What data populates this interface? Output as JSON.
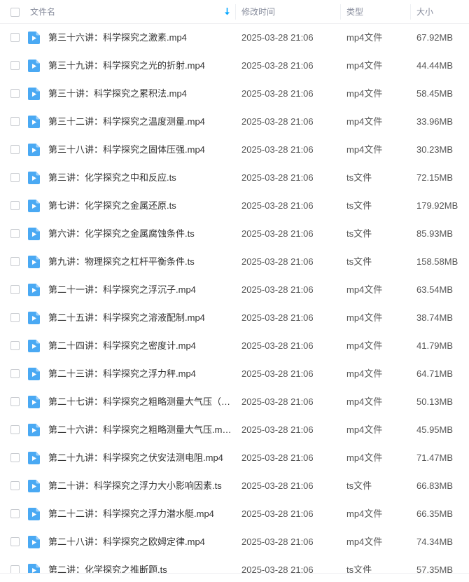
{
  "header": {
    "name_label": "文件名",
    "time_label": "修改时间",
    "type_label": "类型",
    "size_label": "大小"
  },
  "colors": {
    "accent": "#06a7ff",
    "icon": "#4aa9f3",
    "header_text": "#878c9c"
  },
  "files": [
    {
      "name": "第三十六讲：科学探究之激素.mp4",
      "time": "2025-03-28 21:06",
      "type": "mp4文件",
      "size": "67.92MB"
    },
    {
      "name": "第三十九讲：科学探究之光的折射.mp4",
      "time": "2025-03-28 21:06",
      "type": "mp4文件",
      "size": "44.44MB"
    },
    {
      "name": "第三十讲：科学探究之累积法.mp4",
      "time": "2025-03-28 21:06",
      "type": "mp4文件",
      "size": "58.45MB"
    },
    {
      "name": "第三十二讲：科学探究之温度测量.mp4",
      "time": "2025-03-28 21:06",
      "type": "mp4文件",
      "size": "33.96MB"
    },
    {
      "name": "第三十八讲：科学探究之固体压强.mp4",
      "time": "2025-03-28 21:06",
      "type": "mp4文件",
      "size": "30.23MB"
    },
    {
      "name": "第三讲：化学探究之中和反应.ts",
      "time": "2025-03-28 21:06",
      "type": "ts文件",
      "size": "72.15MB"
    },
    {
      "name": "第七讲：化学探究之金属还原.ts",
      "time": "2025-03-28 21:06",
      "type": "ts文件",
      "size": "179.92MB"
    },
    {
      "name": "第六讲：化学探究之金属腐蚀条件.ts",
      "time": "2025-03-28 21:06",
      "type": "ts文件",
      "size": "85.93MB"
    },
    {
      "name": "第九讲：物理探究之杠杆平衡条件.ts",
      "time": "2025-03-28 21:06",
      "type": "ts文件",
      "size": "158.58MB"
    },
    {
      "name": "第二十一讲：科学探究之浮沉子.mp4",
      "time": "2025-03-28 21:06",
      "type": "mp4文件",
      "size": "63.54MB"
    },
    {
      "name": "第二十五讲：科学探究之溶液配制.mp4",
      "time": "2025-03-28 21:06",
      "type": "mp4文件",
      "size": "38.74MB"
    },
    {
      "name": "第二十四讲：科学探究之密度计.mp4",
      "time": "2025-03-28 21:06",
      "type": "mp4文件",
      "size": "41.79MB"
    },
    {
      "name": "第二十三讲：科学探究之浮力秤.mp4",
      "time": "2025-03-28 21:06",
      "type": "mp4文件",
      "size": "64.71MB"
    },
    {
      "name": "第二十七讲：科学探究之粗略测量大气压（吸...",
      "time": "2025-03-28 21:06",
      "type": "mp4文件",
      "size": "50.13MB"
    },
    {
      "name": "第二十六讲：科学探究之粗略测量大气压.mp4",
      "time": "2025-03-28 21:06",
      "type": "mp4文件",
      "size": "45.95MB"
    },
    {
      "name": "第二十九讲：科学探究之伏安法测电阻.mp4",
      "time": "2025-03-28 21:06",
      "type": "mp4文件",
      "size": "71.47MB"
    },
    {
      "name": "第二十讲：科学探究之浮力大小影响因素.ts",
      "time": "2025-03-28 21:06",
      "type": "ts文件",
      "size": "66.83MB"
    },
    {
      "name": "第二十二讲：科学探究之浮力潜水艇.mp4",
      "time": "2025-03-28 21:06",
      "type": "mp4文件",
      "size": "66.35MB"
    },
    {
      "name": "第二十八讲：科学探究之欧姆定律.mp4",
      "time": "2025-03-28 21:06",
      "type": "mp4文件",
      "size": "74.34MB"
    },
    {
      "name": "第二讲：化学探究之推断题.ts",
      "time": "2025-03-28 21:06",
      "type": "ts文件",
      "size": "57.35MB"
    }
  ]
}
